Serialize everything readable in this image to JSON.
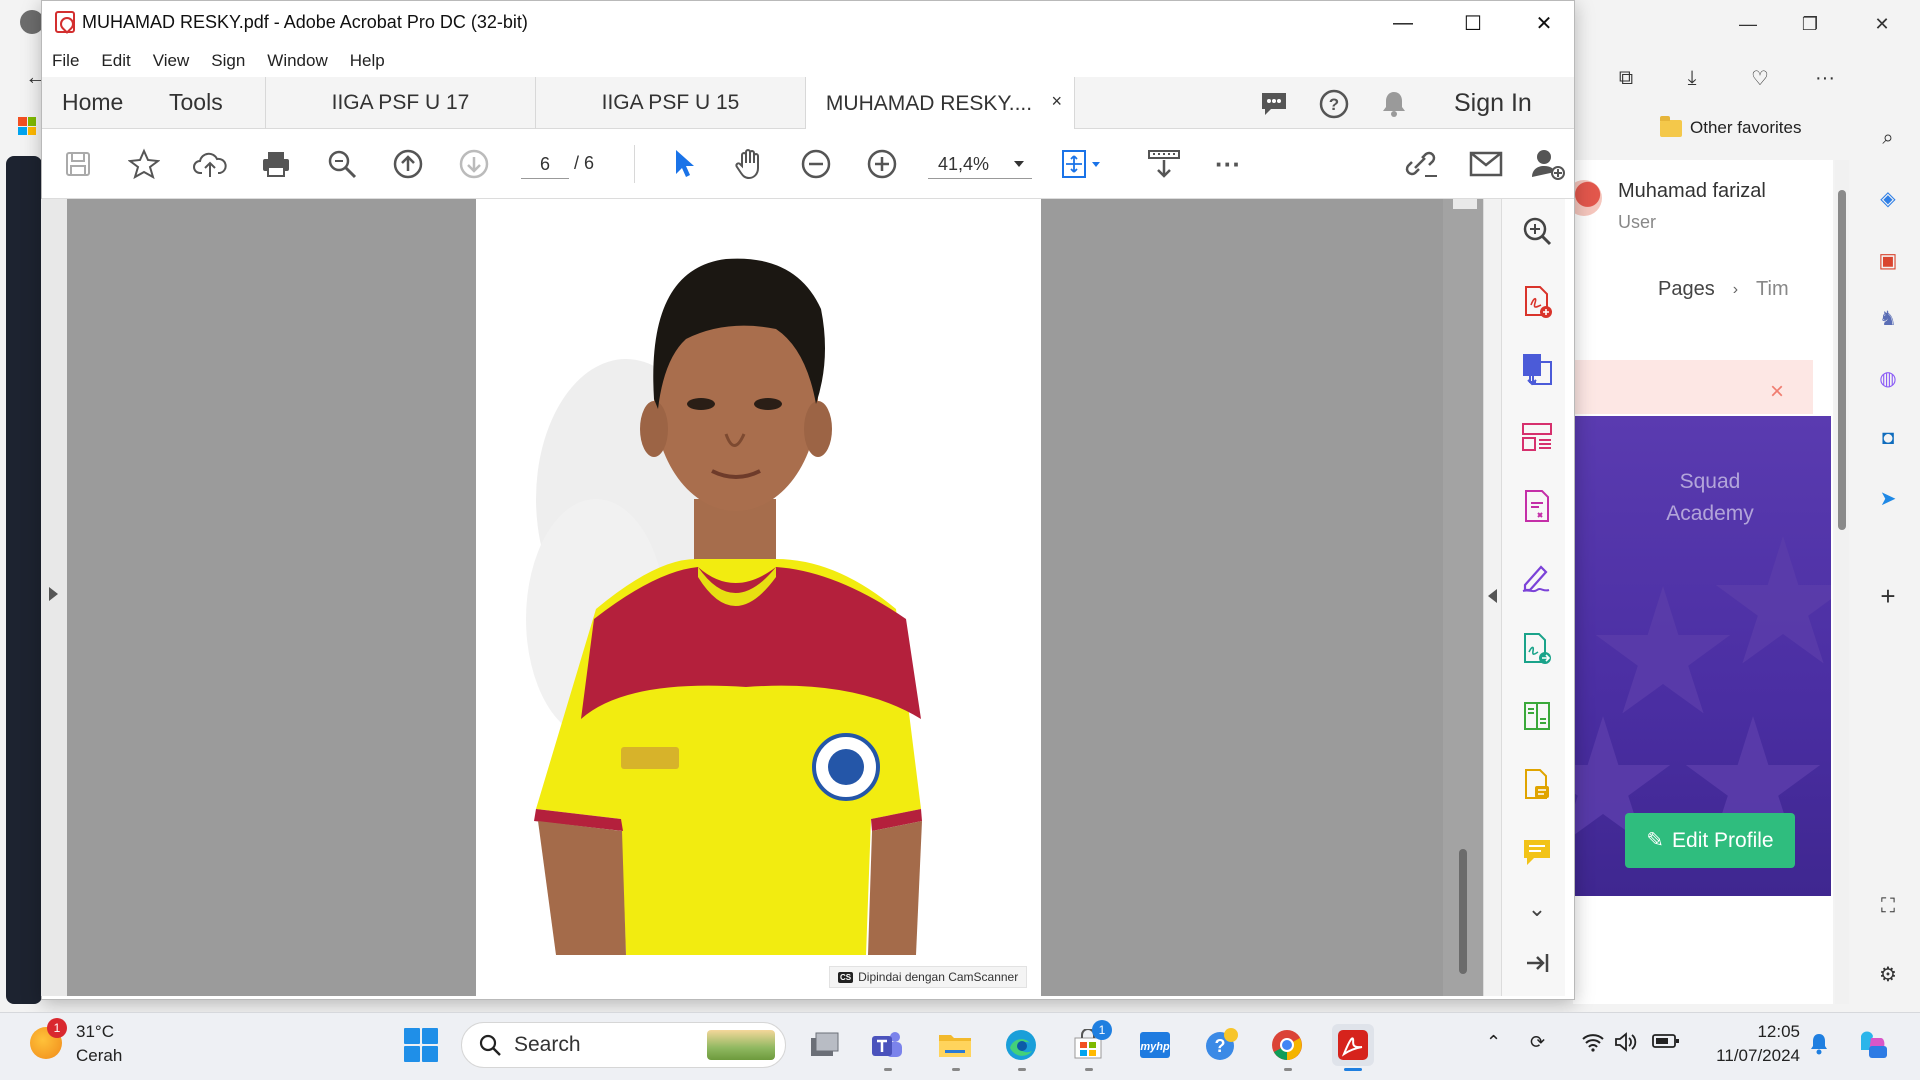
{
  "acrobat": {
    "window_title": "MUHAMAD RESKY.pdf - Adobe Acrobat Pro DC (32-bit)",
    "menu": [
      "File",
      "Edit",
      "View",
      "Sign",
      "Window",
      "Help"
    ],
    "nav": {
      "home": "Home",
      "tools": "Tools"
    },
    "tabs": [
      {
        "label": "IIGA PSF U 17"
      },
      {
        "label": "IIGA PSF U 15"
      },
      {
        "label": "MUHAMAD RESKY....",
        "close": "×",
        "active": true
      }
    ],
    "sign_in": "Sign In",
    "page": {
      "current": "6",
      "total": "/ 6"
    },
    "zoom": "41,4%",
    "document": {
      "watermark": "Dipindai dengan CamScanner",
      "watermark_badge": "CS"
    }
  },
  "edge": {
    "favorites_folder": "Other favorites",
    "user": {
      "name": "Muhamad farizal",
      "role": "User"
    },
    "breadcrumb": {
      "first": "Pages",
      "separator": "›",
      "second": "Tim"
    },
    "alert_close": "×",
    "promo": {
      "line1": "Squad",
      "line2": "Academy"
    },
    "edit_profile": "Edit Profile"
  },
  "taskbar": {
    "weather": {
      "temp": "31°C",
      "condition": "Cerah",
      "badge": "1"
    },
    "search_placeholder": "Search",
    "store_badge": "1",
    "time": "12:05",
    "date": "11/07/2024"
  },
  "colors": {
    "acrobat_red": "#d32f2f",
    "edit_profile_green": "#2fbd7e",
    "promo_purple": "#4a2ea2",
    "selection_blue": "#1a73e8"
  }
}
